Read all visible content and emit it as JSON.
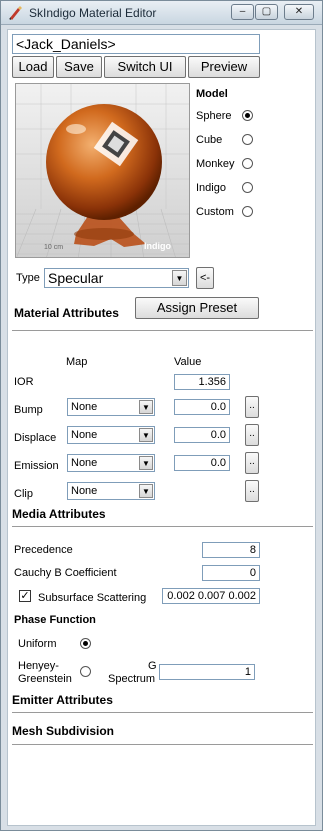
{
  "window": {
    "title": "SkIndigo Material Editor",
    "minimize": "–",
    "restore": "▢",
    "close": "✕"
  },
  "material_name": "<Jack_Daniels>",
  "toolbar": {
    "load": "Load",
    "save": "Save",
    "switch_ui": "Switch UI",
    "preview": "Preview"
  },
  "preview_image": {
    "scale_label": "10 cm",
    "logo_text": "Indigo"
  },
  "model": {
    "heading": "Model",
    "options": [
      {
        "label": "Sphere",
        "checked": true
      },
      {
        "label": "Cube",
        "checked": false
      },
      {
        "label": "Monkey",
        "checked": false
      },
      {
        "label": "Indigo",
        "checked": false
      },
      {
        "label": "Custom",
        "checked": false
      }
    ]
  },
  "type_row": {
    "label": "Type",
    "value": "Specular",
    "back_button": "<-"
  },
  "material_attributes": {
    "heading": "Material Attributes",
    "assign_preset": "Assign Preset",
    "map_header": "Map",
    "value_header": "Value",
    "ior": {
      "label": "IOR",
      "value": "1.356"
    },
    "rows": [
      {
        "label": "Bump",
        "map": "None",
        "value": "0.0",
        "button": ".."
      },
      {
        "label": "Displace",
        "map": "None",
        "value": "0.0",
        "button": ".."
      },
      {
        "label": "Emission",
        "map": "None",
        "value": "0.0",
        "button": ".."
      },
      {
        "label": "Clip",
        "map": "None",
        "value": "",
        "button": ".."
      }
    ]
  },
  "media_attributes": {
    "heading": "Media Attributes",
    "precedence": {
      "label": "Precedence",
      "value": "8"
    },
    "cauchy": {
      "label": "Cauchy B Coefficient",
      "value": "0"
    },
    "subsurface": {
      "label": "Subsurface Scattering",
      "checked": true,
      "value": "0.002 0.007 0.002"
    },
    "phase_function": {
      "heading": "Phase Function",
      "uniform": {
        "label": "Uniform",
        "checked": true
      },
      "henyey": {
        "label_line1": "Henyey-",
        "label_line2": "Greenstein",
        "checked": false
      },
      "g_spectrum": {
        "label_line1": "G",
        "label_line2": "Spectrum",
        "value": "1"
      }
    }
  },
  "emitter_attributes": {
    "heading": "Emitter Attributes"
  },
  "mesh_subdivision": {
    "heading": "Mesh Subdivision"
  },
  "colors": {
    "titlebar_top": "#e9eff4",
    "titlebar_bottom": "#c9d6e1",
    "sphere_orange": "#c85a14",
    "floor_grid": "#d9d9d9"
  }
}
